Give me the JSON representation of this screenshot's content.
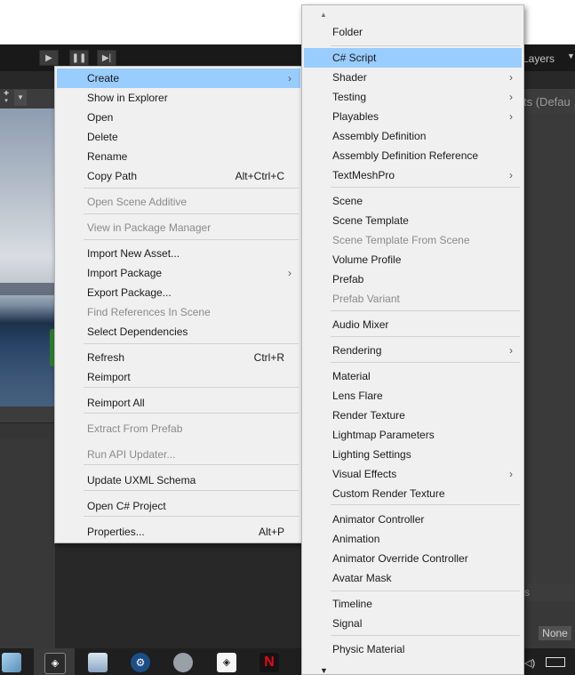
{
  "toolbar": {
    "play_icon": "play-icon",
    "pause_icon": "pause-icon",
    "step_icon": "step-icon",
    "layers_label": "Layers",
    "layers_dropdown_icon": "chevron-down-icon"
  },
  "inspector": {
    "header_text": "ts (Defau",
    "section_text": "s",
    "dropdown_value": "None"
  },
  "context_menu": {
    "items": [
      {
        "label": "Create",
        "shortcut": "",
        "submenu": true,
        "disabled": false,
        "highlighted": true
      },
      {
        "label": "Show in Explorer",
        "shortcut": "",
        "submenu": false,
        "disabled": false
      },
      {
        "label": "Open",
        "shortcut": "",
        "submenu": false,
        "disabled": false
      },
      {
        "label": "Delete",
        "shortcut": "",
        "submenu": false,
        "disabled": false
      },
      {
        "label": "Rename",
        "shortcut": "",
        "submenu": false,
        "disabled": false
      },
      {
        "label": "Copy Path",
        "shortcut": "Alt+Ctrl+C",
        "submenu": false,
        "disabled": false
      },
      {
        "label": "Open Scene Additive",
        "shortcut": "",
        "submenu": false,
        "disabled": true
      },
      {
        "label": "View in Package Manager",
        "shortcut": "",
        "submenu": false,
        "disabled": true
      },
      {
        "label": "Import New Asset...",
        "shortcut": "",
        "submenu": false,
        "disabled": false
      },
      {
        "label": "Import Package",
        "shortcut": "",
        "submenu": true,
        "disabled": false
      },
      {
        "label": "Export Package...",
        "shortcut": "",
        "submenu": false,
        "disabled": false
      },
      {
        "label": "Find References In Scene",
        "shortcut": "",
        "submenu": false,
        "disabled": true
      },
      {
        "label": "Select Dependencies",
        "shortcut": "",
        "submenu": false,
        "disabled": false
      },
      {
        "label": "Refresh",
        "shortcut": "Ctrl+R",
        "submenu": false,
        "disabled": false
      },
      {
        "label": "Reimport",
        "shortcut": "",
        "submenu": false,
        "disabled": false
      },
      {
        "label": "Reimport All",
        "shortcut": "",
        "submenu": false,
        "disabled": false
      },
      {
        "label": "Extract From Prefab",
        "shortcut": "",
        "submenu": false,
        "disabled": true
      },
      {
        "label": "Run API Updater...",
        "shortcut": "",
        "submenu": false,
        "disabled": true
      },
      {
        "label": "Update UXML Schema",
        "shortcut": "",
        "submenu": false,
        "disabled": false
      },
      {
        "label": "Open C# Project",
        "shortcut": "",
        "submenu": false,
        "disabled": false
      },
      {
        "label": "Properties...",
        "shortcut": "Alt+P",
        "submenu": false,
        "disabled": false
      }
    ]
  },
  "create_submenu": {
    "items": [
      {
        "label": "Folder",
        "submenu": false,
        "disabled": false
      },
      {
        "label": "C# Script",
        "submenu": false,
        "disabled": false,
        "highlighted": true
      },
      {
        "label": "Shader",
        "submenu": true,
        "disabled": false
      },
      {
        "label": "Testing",
        "submenu": true,
        "disabled": false
      },
      {
        "label": "Playables",
        "submenu": true,
        "disabled": false
      },
      {
        "label": "Assembly Definition",
        "submenu": false,
        "disabled": false
      },
      {
        "label": "Assembly Definition Reference",
        "submenu": false,
        "disabled": false
      },
      {
        "label": "TextMeshPro",
        "submenu": true,
        "disabled": false
      },
      {
        "label": "Scene",
        "submenu": false,
        "disabled": false
      },
      {
        "label": "Scene Template",
        "submenu": false,
        "disabled": false
      },
      {
        "label": "Scene Template From Scene",
        "submenu": false,
        "disabled": true
      },
      {
        "label": "Volume Profile",
        "submenu": false,
        "disabled": false
      },
      {
        "label": "Prefab",
        "submenu": false,
        "disabled": false
      },
      {
        "label": "Prefab Variant",
        "submenu": false,
        "disabled": true
      },
      {
        "label": "Audio Mixer",
        "submenu": false,
        "disabled": false
      },
      {
        "label": "Rendering",
        "submenu": true,
        "disabled": false
      },
      {
        "label": "Material",
        "submenu": false,
        "disabled": false
      },
      {
        "label": "Lens Flare",
        "submenu": false,
        "disabled": false
      },
      {
        "label": "Render Texture",
        "submenu": false,
        "disabled": false
      },
      {
        "label": "Lightmap Parameters",
        "submenu": false,
        "disabled": false
      },
      {
        "label": "Lighting Settings",
        "submenu": false,
        "disabled": false
      },
      {
        "label": "Visual Effects",
        "submenu": true,
        "disabled": false
      },
      {
        "label": "Custom Render Texture",
        "submenu": false,
        "disabled": false
      },
      {
        "label": "Animator Controller",
        "submenu": false,
        "disabled": false
      },
      {
        "label": "Animation",
        "submenu": false,
        "disabled": false
      },
      {
        "label": "Animator Override Controller",
        "submenu": false,
        "disabled": false
      },
      {
        "label": "Avatar Mask",
        "submenu": false,
        "disabled": false
      },
      {
        "label": "Timeline",
        "submenu": false,
        "disabled": false
      },
      {
        "label": "Signal",
        "submenu": false,
        "disabled": false
      },
      {
        "label": "Physic Material",
        "submenu": false,
        "disabled": false
      }
    ],
    "scroll_up_icon": "scroll-up-arrow-icon",
    "scroll_down_icon": "scroll-down-arrow-icon"
  },
  "taskbar": {
    "icons": [
      "glass-app-icon",
      "unity-hub-icon",
      "photos-icon",
      "steam-icon",
      "audio-app-icon",
      "unity-icon",
      "netflix-icon"
    ],
    "tray_icon": "volume-icon",
    "keyboard_icon": "keyboard-icon"
  },
  "colors": {
    "menu_bg": "#f0f0f0",
    "highlight": "#99ccff",
    "disabled_text": "#8a8a8a",
    "editor_dark": "#191919"
  }
}
